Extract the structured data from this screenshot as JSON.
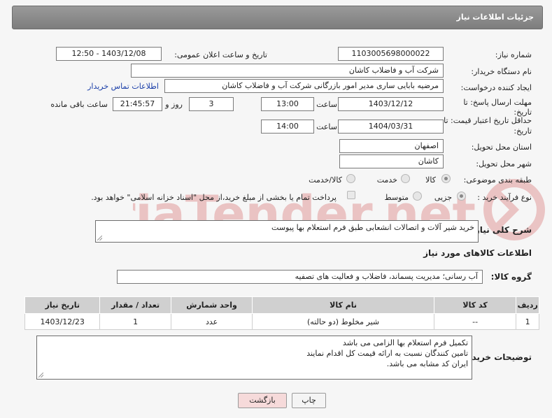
{
  "header": {
    "title": "جزئیات اطلاعات نیاز"
  },
  "form": {
    "need_number": {
      "label": "شماره نیاز:",
      "value": "1103005698000022"
    },
    "announce_datetime": {
      "label": "تاریخ و ساعت اعلان عمومی:",
      "value": "1403/12/08 - 12:50"
    },
    "buyer_org": {
      "label": "نام دستگاه خریدار:",
      "value": "شرکت آب و فاضلاب کاشان"
    },
    "requester": {
      "label": "ایجاد کننده درخواست:",
      "value": "مرضیه بابایی ساری مدیر امور بازرگانی شرکت آب و فاضلاب کاشان",
      "contact_link": "اطلاعات تماس خریدار"
    },
    "reply_deadline": {
      "label_line1": "مهلت ارسال پاسخ: تا",
      "label_line2": "تاریخ:",
      "date": "1403/12/12",
      "time_label": "ساعت",
      "time": "13:00",
      "days": "3",
      "days_label": "روز و",
      "remaining": "21:45:57",
      "remaining_label": "ساعت باقی مانده"
    },
    "price_validity": {
      "label_line1": "حداقل تاریخ اعتبار قیمت: تا",
      "label_line2": "تاریخ:",
      "date": "1404/03/31",
      "time_label": "ساعت",
      "time": "14:00"
    },
    "delivery_province": {
      "label": "استان محل تحویل:",
      "value": "اصفهان"
    },
    "delivery_city": {
      "label": "شهر محل تحویل:",
      "value": "کاشان"
    },
    "subject_class": {
      "label": "طبقه بندی موضوعی:",
      "options": [
        "کالا",
        "خدمت",
        "کالا/خدمت"
      ],
      "selected": "کالا"
    },
    "purchase_type": {
      "label": "نوع فرآیند خرید :",
      "options": [
        "جزیی",
        "متوسط"
      ],
      "selected": "جزیی",
      "note": "پرداخت تمام یا بخشی از مبلغ خرید،از محل \"اسناد خزانه اسلامی\" خواهد بود."
    }
  },
  "summary": {
    "label": "شرح کلی نیاز:",
    "text": "خرید شیر آلات و اتصالات انشعابی طبق فرم استعلام بها پیوست"
  },
  "goods_section": {
    "title": "اطلاعات کالاهای مورد نیاز",
    "group_label": "گروه کالا:",
    "group_value": "آب رسانی؛ مدیریت پسماند، فاضلاب و فعالیت های تصفیه"
  },
  "table": {
    "headers": [
      "ردیف",
      "کد کالا",
      "نام کالا",
      "واحد شمارش",
      "تعداد / مقدار",
      "تاریخ نیاز"
    ],
    "rows": [
      [
        "1",
        "--",
        "شیر مخلوط (دو حالته)",
        "عدد",
        "1",
        "1403/12/23"
      ]
    ]
  },
  "buyer_notes": {
    "label": "توضیحات خریدار:",
    "lines": [
      "تکمیل فرم استعلام بها الزامی می باشد",
      "تامین کنندگان نسبت به ارائه قیمت کل اقدام نمایند",
      "ایران کد مشابه می باشد."
    ]
  },
  "buttons": {
    "print": "چاپ",
    "back": "بازگشت"
  },
  "watermark": {
    "text": "AriaTender.net"
  },
  "colors": {
    "header_bg": "#8a8a8a",
    "link": "#1a3ea8",
    "back_button": "#f6dada",
    "watermark": "#e4b9b9"
  }
}
